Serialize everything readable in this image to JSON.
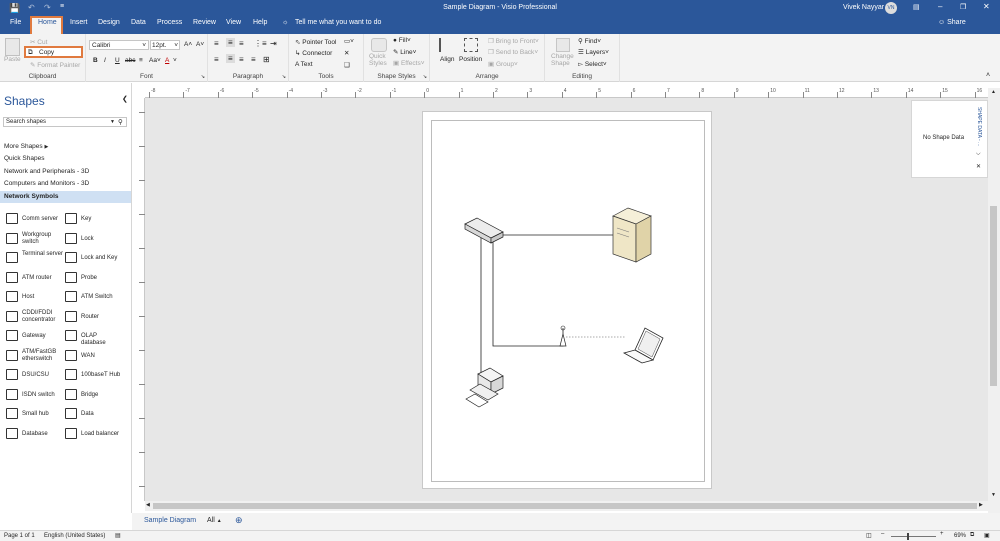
{
  "window": {
    "title": "Sample Diagram  -  Visio Professional",
    "user": "Vivek Nayyar",
    "user_initials": "VN",
    "share": "Share"
  },
  "tabs": [
    "File",
    "Home",
    "Insert",
    "Design",
    "Data",
    "Process",
    "Review",
    "View",
    "Help"
  ],
  "tell_me": "Tell me what you want to do",
  "ribbon": {
    "clipboard": {
      "label": "Clipboard",
      "paste": "Paste",
      "cut": "Cut",
      "copy": "Copy",
      "format_painter": "Format Painter"
    },
    "font": {
      "label": "Font",
      "family": "Calibri",
      "size": "12pt."
    },
    "paragraph": {
      "label": "Paragraph"
    },
    "tools": {
      "label": "Tools",
      "pointer": "Pointer Tool",
      "connector": "Connector",
      "text": "Text"
    },
    "shape_styles": {
      "label": "Shape Styles",
      "quick_styles": "Quick Styles",
      "fill": "Fill",
      "line": "Line",
      "effects": "Effects"
    },
    "arrange": {
      "label": "Arrange",
      "align": "Align",
      "position": "Position",
      "bring_front": "Bring to Front",
      "send_back": "Send to Back",
      "group": "Group"
    },
    "editing": {
      "label": "Editing",
      "change_shape": "Change Shape",
      "find": "Find",
      "layers": "Layers",
      "select": "Select"
    }
  },
  "shapes_pane": {
    "title": "Shapes",
    "search_placeholder": "Search shapes",
    "items": [
      "More Shapes",
      "Quick Shapes",
      "Network and Peripherals - 3D",
      "Computers and Monitors - 3D",
      "Network Symbols"
    ],
    "stencils": [
      [
        "Comm server",
        "Key"
      ],
      [
        "Workgroup switch",
        "Lock"
      ],
      [
        "Terminal server",
        "Lock and Key"
      ],
      [
        "ATM router",
        "Probe"
      ],
      [
        "Host",
        "ATM Switch"
      ],
      [
        "CDDI/FDDI concentrator",
        "Router"
      ],
      [
        "Gateway",
        "OLAP database"
      ],
      [
        "ATM/FastGB etherswitch",
        "WAN"
      ],
      [
        "DSU/CSU",
        "100baseT Hub"
      ],
      [
        "ISDN switch",
        "Bridge"
      ],
      [
        "Small hub",
        "Data"
      ],
      [
        "Database",
        "Load balancer"
      ]
    ]
  },
  "ruler_ticks": [
    "-8",
    "-7",
    "-6",
    "-5",
    "-4",
    "-3",
    "-2",
    "-1",
    "0",
    "1",
    "2",
    "3",
    "4",
    "5",
    "6",
    "7",
    "8",
    "9",
    "10",
    "11",
    "12",
    "13",
    "14",
    "15",
    "16"
  ],
  "shape_data": {
    "title": "SHAPE DATA - ...",
    "empty": "No Shape Data"
  },
  "sheet_tab": "Sample Diagram",
  "all_tab": "All",
  "status": {
    "page": "Page 1 of 1",
    "language": "English (United States)",
    "zoom": "69%"
  }
}
